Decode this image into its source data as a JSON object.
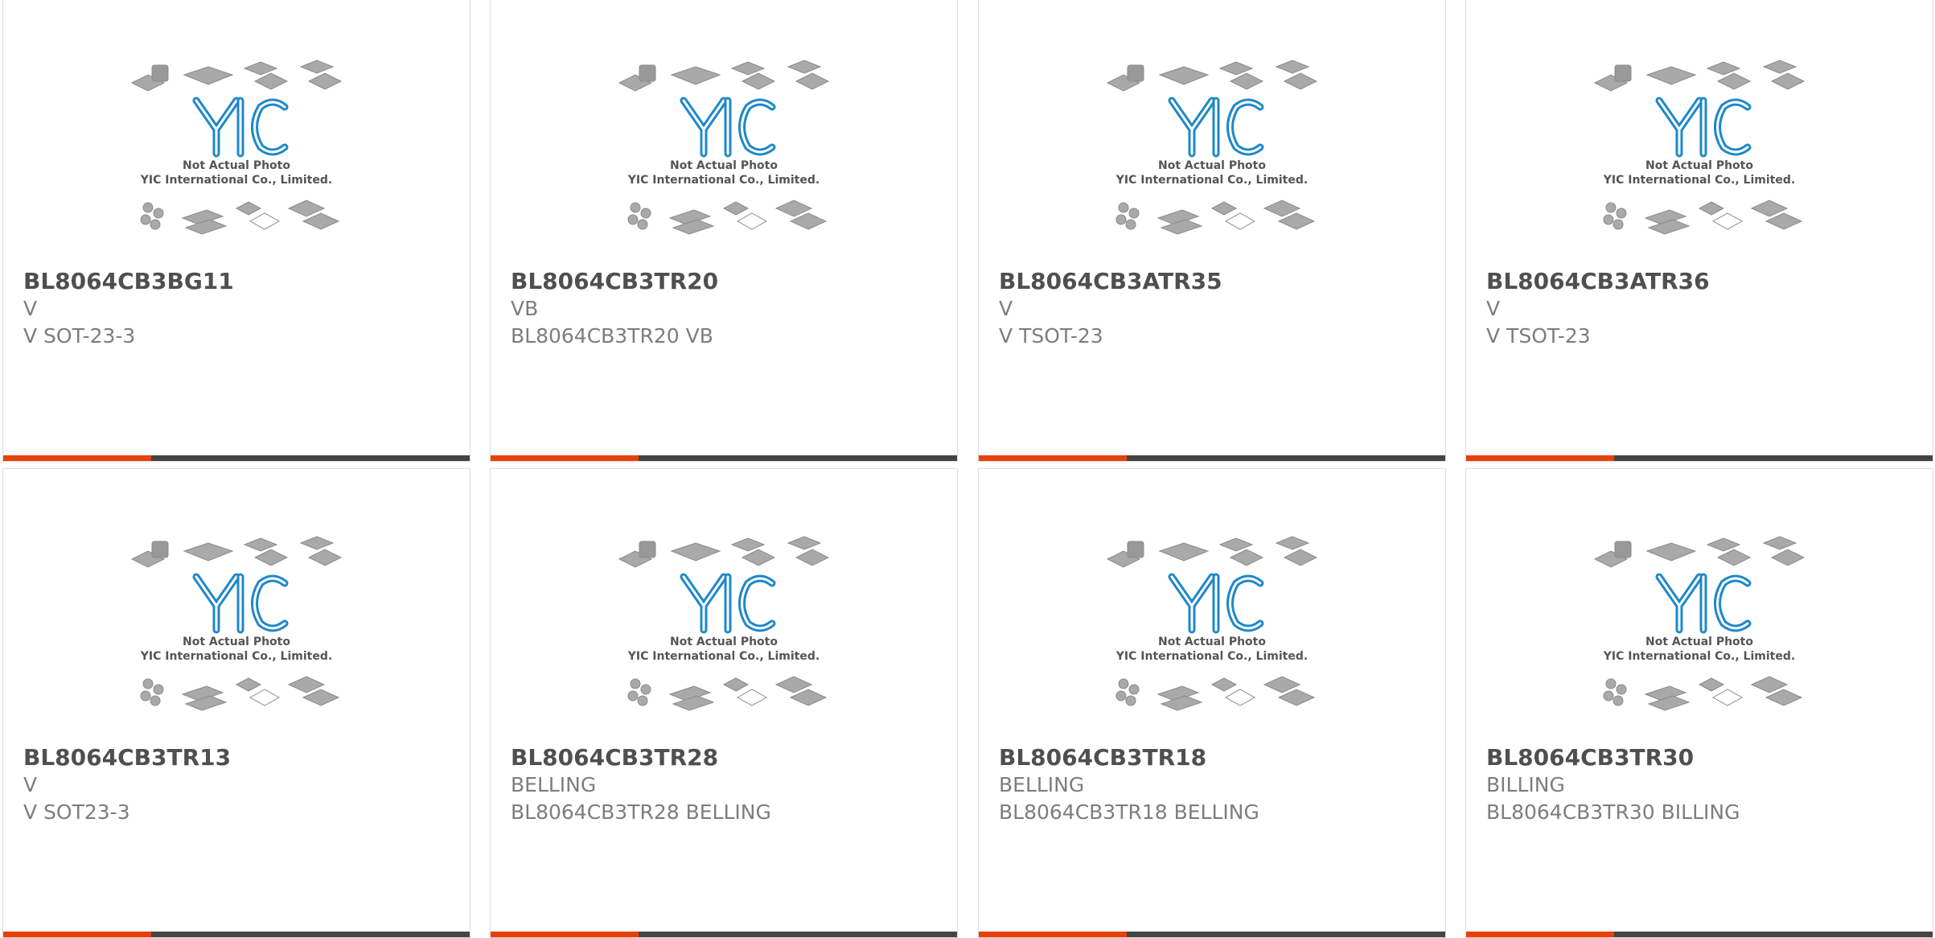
{
  "placeholder": {
    "line1": "Not Actual Photo",
    "line2": "YIC International Co., Limited.",
    "logo_text": "YIC"
  },
  "colors": {
    "accent": "#e8400c",
    "bar": "#444444",
    "logo": "#1e88c8"
  },
  "cards": [
    {
      "part": "BL8064CB3BG11",
      "manufacturer": "V",
      "description": "V SOT-23-3"
    },
    {
      "part": "BL8064CB3TR20",
      "manufacturer": "VB",
      "description": "BL8064CB3TR20 VB"
    },
    {
      "part": "BL8064CB3ATR35",
      "manufacturer": "V",
      "description": "V TSOT-23"
    },
    {
      "part": "BL8064CB3ATR36",
      "manufacturer": "V",
      "description": "V TSOT-23"
    },
    {
      "part": "BL8064CB3TR13",
      "manufacturer": "V",
      "description": "V SOT23-3"
    },
    {
      "part": "BL8064CB3TR28",
      "manufacturer": "BELLING",
      "description": "BL8064CB3TR28 BELLING"
    },
    {
      "part": "BL8064CB3TR18",
      "manufacturer": "BELLING",
      "description": "BL8064CB3TR18 BELLING"
    },
    {
      "part": "BL8064CB3TR30",
      "manufacturer": "BILLING",
      "description": "BL8064CB3TR30 BILLING"
    }
  ]
}
